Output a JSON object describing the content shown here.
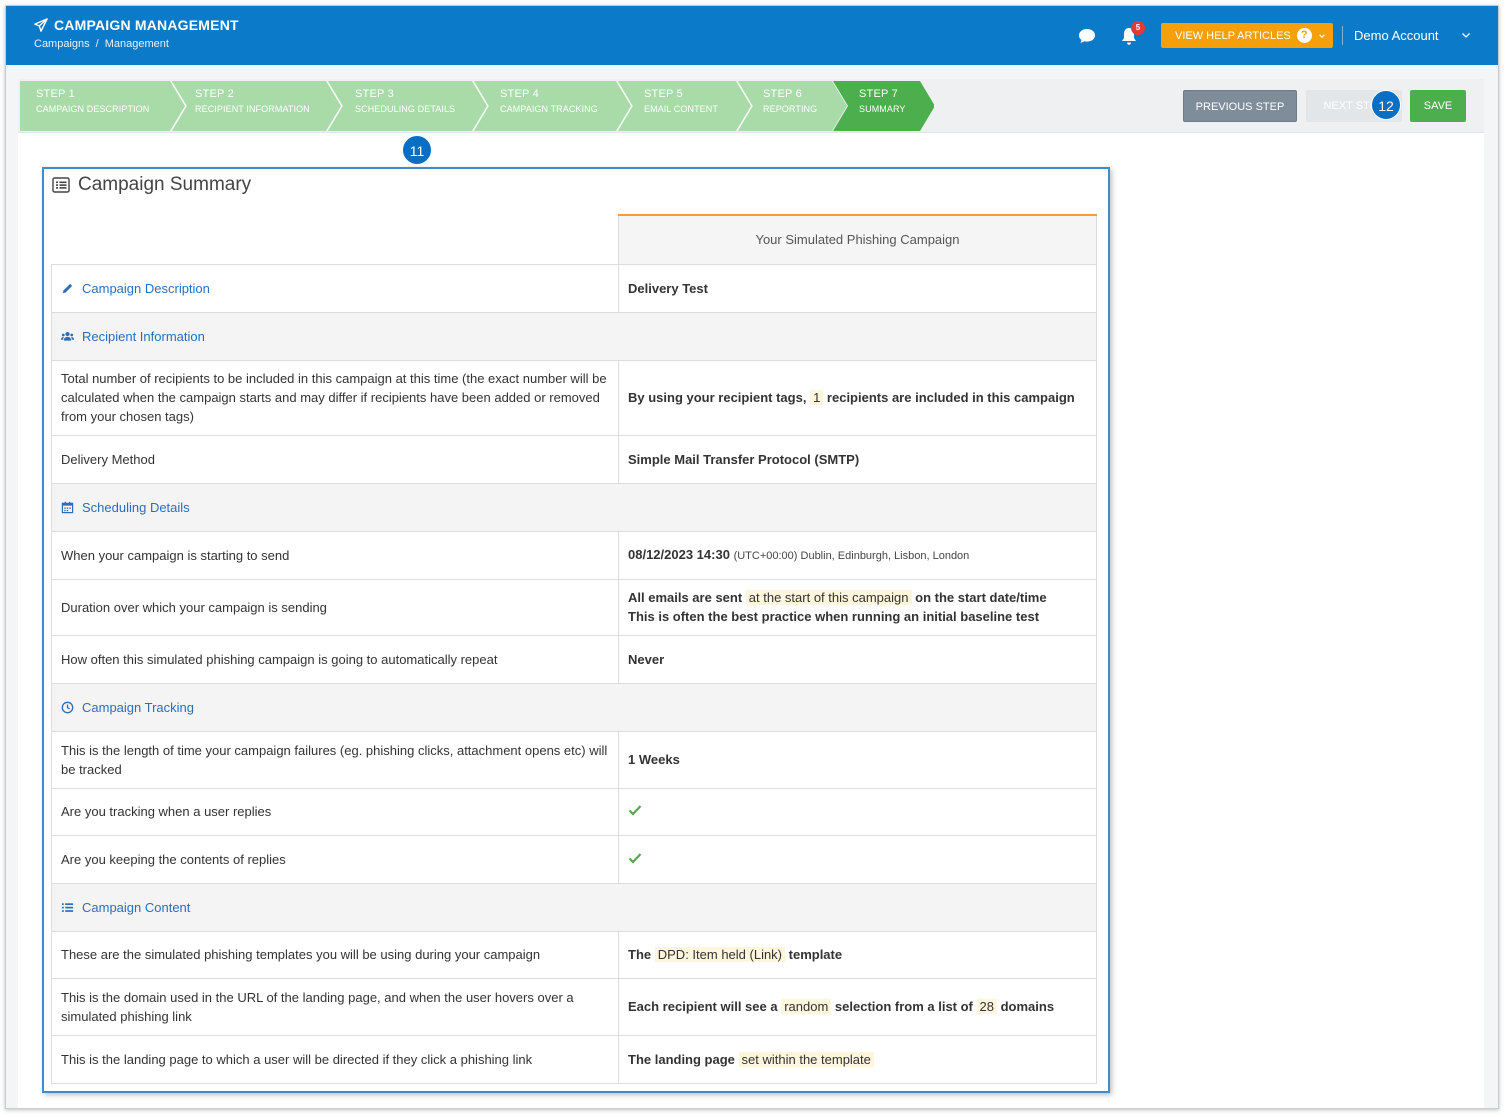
{
  "header": {
    "app_title": "CAMPAIGN MANAGEMENT",
    "breadcrumb": [
      "Campaigns",
      "/",
      "Management"
    ],
    "notification_count": "5",
    "help_button": "VIEW HELP ARTICLES",
    "account": "Demo Account",
    "icons": [
      "paper-plane-icon",
      "chat-icon",
      "bell-icon",
      "question-icon",
      "chevron-down-icon"
    ],
    "colors": {
      "topbar": "#0a7ac9",
      "help": "#f5a00b"
    }
  },
  "steps": [
    {
      "num": "STEP 1",
      "label": "CAMPAIGN DESCRIPTION",
      "state": "done"
    },
    {
      "num": "STEP 2",
      "label": "RECIPIENT INFORMATION",
      "state": "done"
    },
    {
      "num": "STEP 3",
      "label": "SCHEDULING DETAILS",
      "state": "done"
    },
    {
      "num": "STEP 4",
      "label": "CAMPAIGN TRACKING",
      "state": "done"
    },
    {
      "num": "STEP 5",
      "label": "EMAIL CONTENT",
      "state": "done"
    },
    {
      "num": "STEP 6",
      "label": "REPORTING",
      "state": "done"
    },
    {
      "num": "STEP 7",
      "label": "SUMMARY",
      "state": "active"
    }
  ],
  "step_colors": {
    "done": "#a8dba8",
    "active": "#4cae4c"
  },
  "actions": {
    "previous": "PREVIOUS STEP",
    "next": "NEXT STEP",
    "save": "SAVE"
  },
  "callouts": [
    "11",
    "12"
  ],
  "summary": {
    "title": "Campaign Summary",
    "column_header": "Your Simulated Phishing Campaign",
    "sections": {
      "description": "Campaign Description",
      "recipients": "Recipient Information",
      "scheduling": "Scheduling Details",
      "tracking": "Campaign Tracking",
      "content": "Campaign Content"
    },
    "rows": {
      "campaign_name": "Delivery Test",
      "recipients_label": "Total number of recipients to be included in this campaign at this time (the exact number will be calculated when the campaign starts and may differ if recipients have been added or removed from your chosen tags)",
      "recipients_pre": "By using your recipient tags,",
      "recipients_count": "1",
      "recipients_post": "recipients are included in this campaign",
      "delivery_label": "Delivery Method",
      "delivery_value": "Simple Mail Transfer Protocol (SMTP)",
      "start_label": "When your campaign is starting to send",
      "start_datetime": "08/12/2023 14:30",
      "start_timezone": "(UTC+00:00) Dublin, Edinburgh, Lisbon, London",
      "duration_label": "Duration over which your campaign is sending",
      "duration_pre": "All emails are sent",
      "duration_hl": "at the start of this campaign",
      "duration_post": "on the start date/time",
      "duration_note": "This is often the best practice when running an initial baseline test",
      "repeat_label": "How often this simulated phishing campaign is going to automatically repeat",
      "repeat_value": "Never",
      "tracking_label": "This is the length of time your campaign failures (eg. phishing clicks, attachment opens etc) will be tracked",
      "tracking_value": "1 Weeks",
      "replies_label": "Are you tracking when a user replies",
      "keep_label": "Are you keeping the contents of replies",
      "templates_label": "These are the simulated phishing templates you will be using during your campaign",
      "templates_pre": "The",
      "templates_hl": "DPD: Item held (Link)",
      "templates_post": "template",
      "domain_label": "This is the domain used in the URL of the landing page, and when the user hovers over a simulated phishing link",
      "domain_pre": "Each recipient will see a",
      "domain_hl": "random",
      "domain_mid": "selection from a list of",
      "domain_count": "28",
      "domain_post": "domains",
      "landing_label": "This is the landing page to which a user will be directed if they click a phishing link",
      "landing_pre": "The landing page",
      "landing_hl": "set within the template"
    }
  }
}
